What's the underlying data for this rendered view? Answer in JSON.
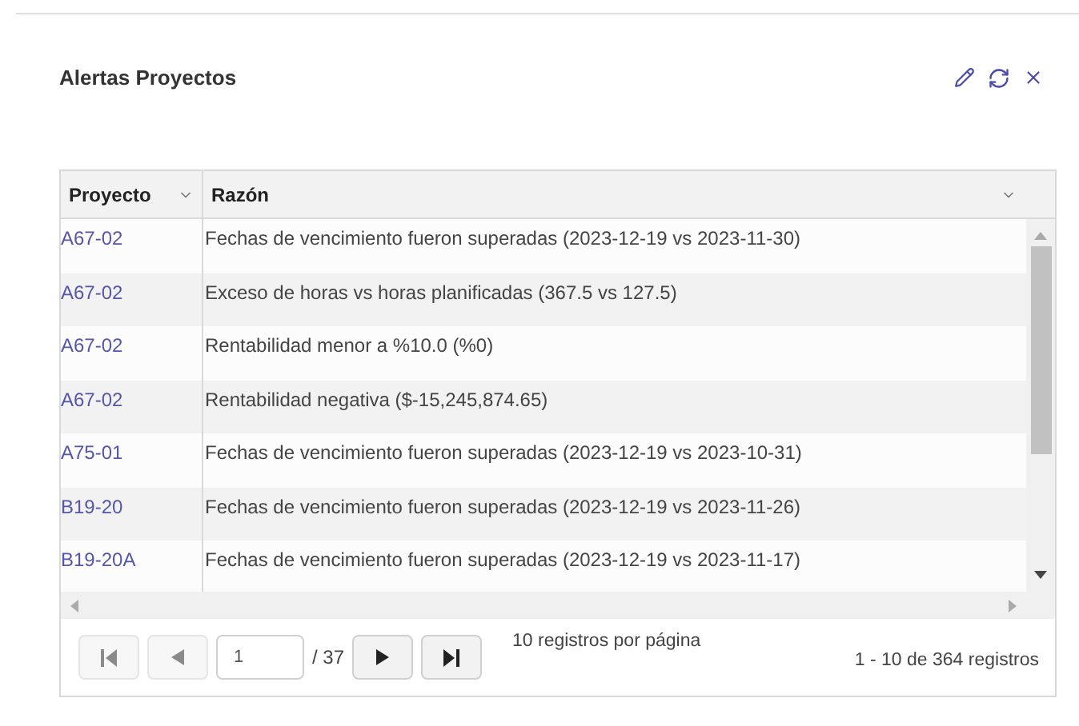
{
  "title": "Alertas Proyectos",
  "table": {
    "columns": [
      "Proyecto",
      "Razón"
    ],
    "rows": [
      {
        "project": "A67-02",
        "reason": "Fechas de vencimiento fueron superadas (2023-12-19 vs 2023-11-30)"
      },
      {
        "project": "A67-02",
        "reason": "Exceso de horas vs horas planificadas (367.5 vs 127.5)"
      },
      {
        "project": "A67-02",
        "reason": "Rentabilidad menor a %10.0 (%0)"
      },
      {
        "project": "A67-02",
        "reason": "Rentabilidad negativa ($-15,245,874.65)"
      },
      {
        "project": "A75-01",
        "reason": "Fechas de vencimiento fueron superadas (2023-12-19 vs 2023-10-31)"
      },
      {
        "project": "B19-20",
        "reason": "Fechas de vencimiento fueron superadas (2023-12-19 vs 2023-11-26)"
      },
      {
        "project": "B19-20A",
        "reason": "Fechas de vencimiento fueron superadas (2023-12-19 vs 2023-11-17)"
      }
    ]
  },
  "pager": {
    "page": "1",
    "total_pages": "/ 37",
    "per_page": "10 registros por página",
    "summary": "1 - 10 de 364 registros",
    "buttons": [
      {
        "kind": "first",
        "disabled": true
      },
      {
        "kind": "prev",
        "disabled": true
      },
      {
        "kind": "next",
        "disabled": false
      },
      {
        "kind": "last",
        "disabled": false
      }
    ]
  }
}
